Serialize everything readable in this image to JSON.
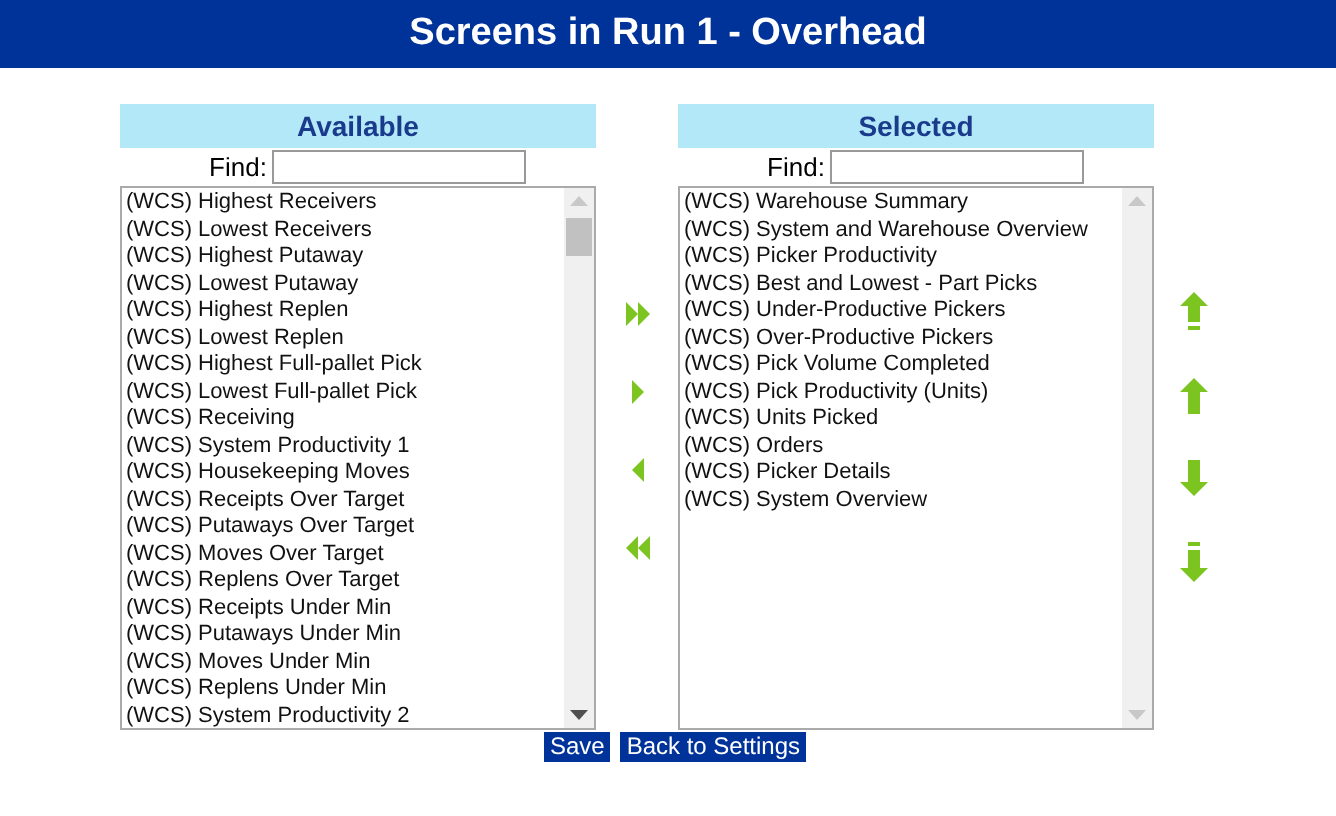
{
  "title": "Screens in Run 1 - Overhead",
  "panels": [
    {
      "heading": "Available",
      "find_label": "Find:",
      "items": [
        "(WCS) Highest Receivers",
        "(WCS) Lowest Receivers",
        "(WCS) Highest Putaway",
        "(WCS) Lowest Putaway",
        "(WCS) Highest Replen",
        "(WCS) Lowest Replen",
        "(WCS) Highest Full-pallet Pick",
        "(WCS) Lowest Full-pallet Pick",
        "(WCS) Receiving",
        "(WCS) System Productivity 1",
        "(WCS) Housekeeping Moves",
        "(WCS) Receipts Over Target",
        "(WCS) Putaways Over Target",
        "(WCS) Moves Over Target",
        "(WCS) Replens Over Target",
        "(WCS) Receipts Under Min",
        "(WCS) Putaways Under Min",
        "(WCS) Moves Under Min",
        "(WCS) Replens Under Min",
        "(WCS) System Productivity 2"
      ]
    },
    {
      "heading": "Selected",
      "find_label": "Find:",
      "items": [
        "(WCS) Warehouse Summary",
        "(WCS) System and Warehouse Overview",
        "(WCS) Picker Productivity",
        "(WCS) Best and Lowest - Part Picks",
        "(WCS) Under-Productive Pickers",
        "(WCS) Over-Productive Pickers",
        "(WCS) Pick Volume Completed",
        "(WCS) Pick Productivity (Units)",
        "(WCS) Units Picked",
        "(WCS) Orders",
        "(WCS) Picker Details",
        "(WCS) System Overview"
      ]
    }
  ],
  "buttons": [
    "Save",
    "Back to Settings"
  ]
}
